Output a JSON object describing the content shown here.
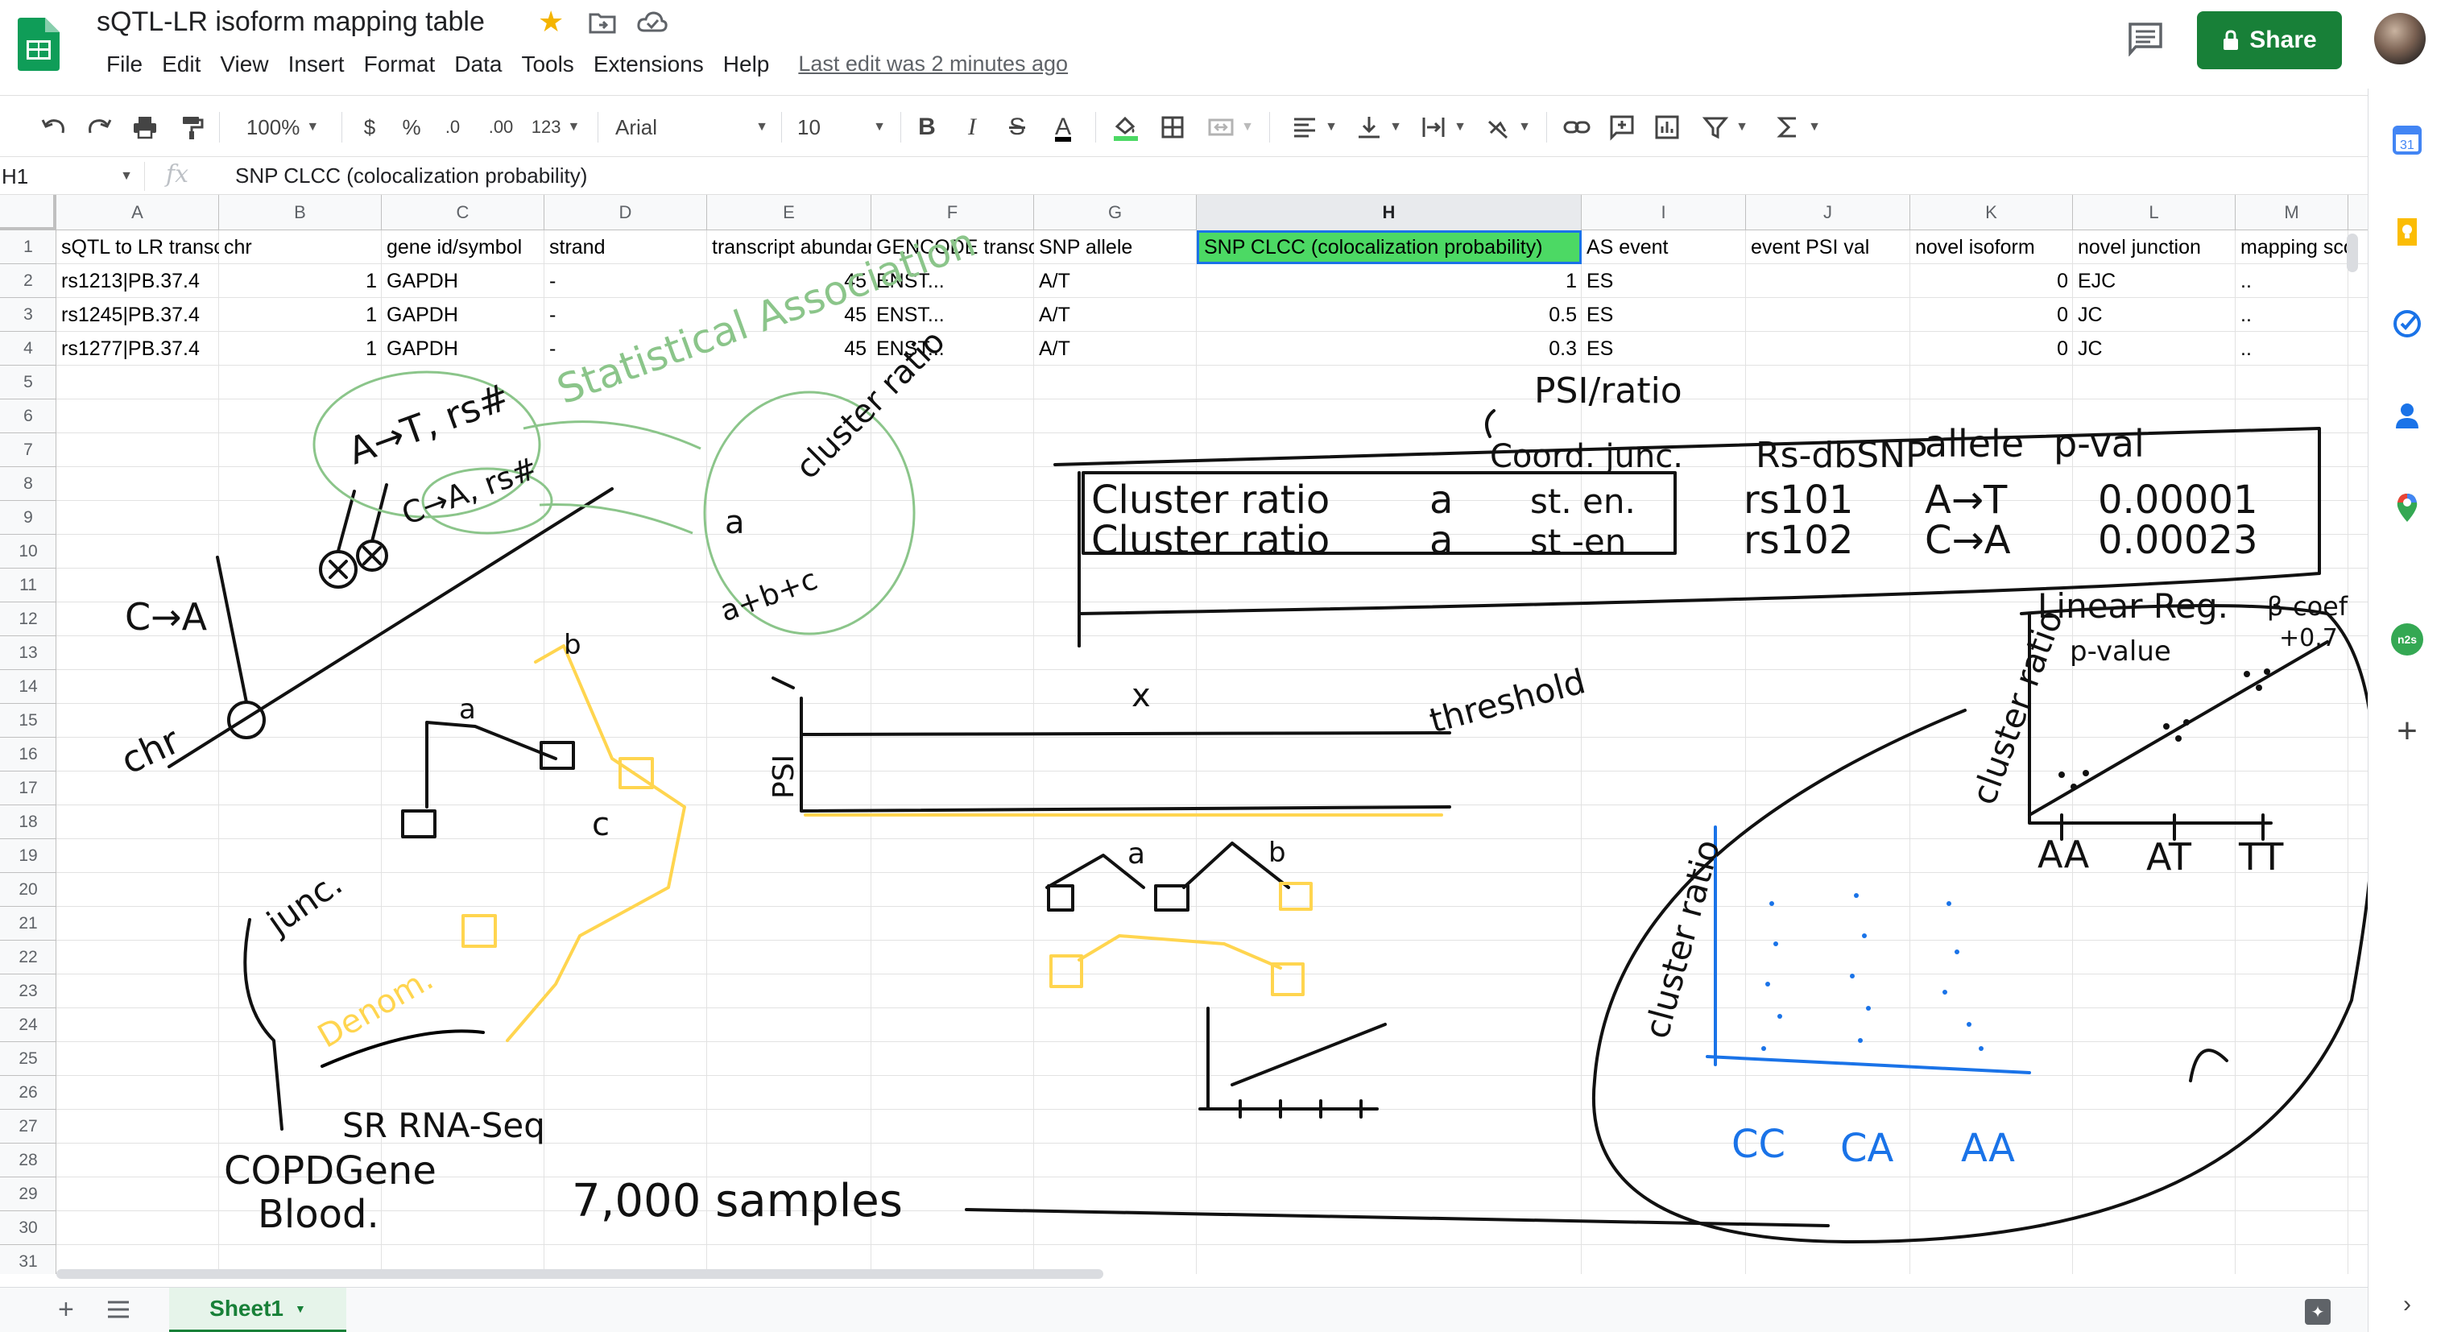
{
  "app": {
    "title": "sQTL-LR isoform mapping table",
    "menu": [
      "File",
      "Edit",
      "View",
      "Insert",
      "Format",
      "Data",
      "Tools",
      "Extensions",
      "Help"
    ],
    "last_edit": "Last edit was 2 minutes ago",
    "share_label": "Share",
    "brand_color": "#188038"
  },
  "toolbar": {
    "zoom": "100%",
    "currency": "$",
    "percent": "%",
    "decrease_decimal": ".0",
    "increase_decimal": ".00",
    "more_formats": "123",
    "font": "Arial",
    "font_size": "10",
    "bold": "B",
    "italic": "I",
    "strikethrough": "S",
    "text_color": "A"
  },
  "formula_bar": {
    "cell_ref": "H1",
    "fx": "fx",
    "content": "SNP CLCC (colocalization probability)"
  },
  "grid": {
    "columns": [
      "A",
      "B",
      "C",
      "D",
      "E",
      "F",
      "G",
      "H",
      "I",
      "J",
      "K",
      "L",
      "M"
    ],
    "selected_column": "H",
    "rows": [
      "1",
      "2",
      "3",
      "4",
      "5",
      "6",
      "7",
      "8",
      "9",
      "10",
      "11",
      "12",
      "13",
      "14",
      "15",
      "16",
      "17",
      "18",
      "19",
      "20",
      "21",
      "22",
      "23",
      "24",
      "25",
      "26",
      "27",
      "28",
      "29",
      "30",
      "31"
    ],
    "header_row": [
      "sQTL to LR transcript",
      "chr",
      "gene id/symbol",
      "strand",
      "transcript abundance",
      "GENCODE transcript",
      "SNP allele",
      "SNP CLCC (colocalization probability)",
      "AS event",
      "event PSI val",
      "novel isoform",
      "novel junction",
      "mapping score"
    ],
    "data_rows": [
      [
        "rs1213|PB.37.4",
        "1",
        "GAPDH",
        "-",
        "45",
        "ENST...",
        "A/T",
        "1",
        "ES",
        "",
        "0",
        "EJC",
        ".."
      ],
      [
        "rs1245|PB.37.4",
        "1",
        "GAPDH",
        "-",
        "45",
        "ENST...",
        "A/T",
        "0.5",
        "ES",
        "",
        "0",
        "JC",
        ".."
      ],
      [
        "rs1277|PB.37.4",
        "1",
        "GAPDH",
        "-",
        "45",
        "ENST...",
        "A/T",
        "0.3",
        "ES",
        "",
        "0",
        "JC",
        ".."
      ]
    ]
  },
  "sheet_tab": "Sheet1",
  "handwriting": {
    "statistical_association": "Statistical Association",
    "a_t_rs": "A→T, rs#",
    "c_a_rs": "C→A, rs#",
    "c_a": "C→A",
    "chr": "chr",
    "cluster_ratio": "cluster ratio",
    "a": "a",
    "a_b_c": "a+b+c",
    "psi_ratio": "PSI/ratio",
    "coord_junc": "Coord. junc.",
    "rs_dbsnp": "Rs-dbSNP",
    "allele": "allele",
    "p_val": "p-val",
    "table_row1": [
      "Cluster ratio",
      "a",
      "st. en.",
      "rs101",
      "A→T",
      "0.00001"
    ],
    "table_row2": [
      "Cluster ratio",
      "a",
      "st -en",
      "rs102",
      "C→A",
      "0.00023"
    ],
    "linear_reg": "Linear Reg.",
    "beta_coef": "β-coef",
    "beta_value": "+0.7",
    "p_value": "p-value",
    "cluster_ratio_axis": "cluster ratio",
    "genotypes_black": [
      "AA",
      "AT",
      "TT"
    ],
    "genotypes_blue": [
      "CC",
      "CA",
      "AA"
    ],
    "threshold": "threshold",
    "psi_label": "PSI",
    "x": "x",
    "b": "b",
    "c": "c",
    "junc": "junc.",
    "denom": "Denom.",
    "sr_rna_seq": "SR RNA-Seq",
    "copdgene": "COPDGene",
    "blood": "Blood.",
    "samples": "7,000 samples"
  }
}
